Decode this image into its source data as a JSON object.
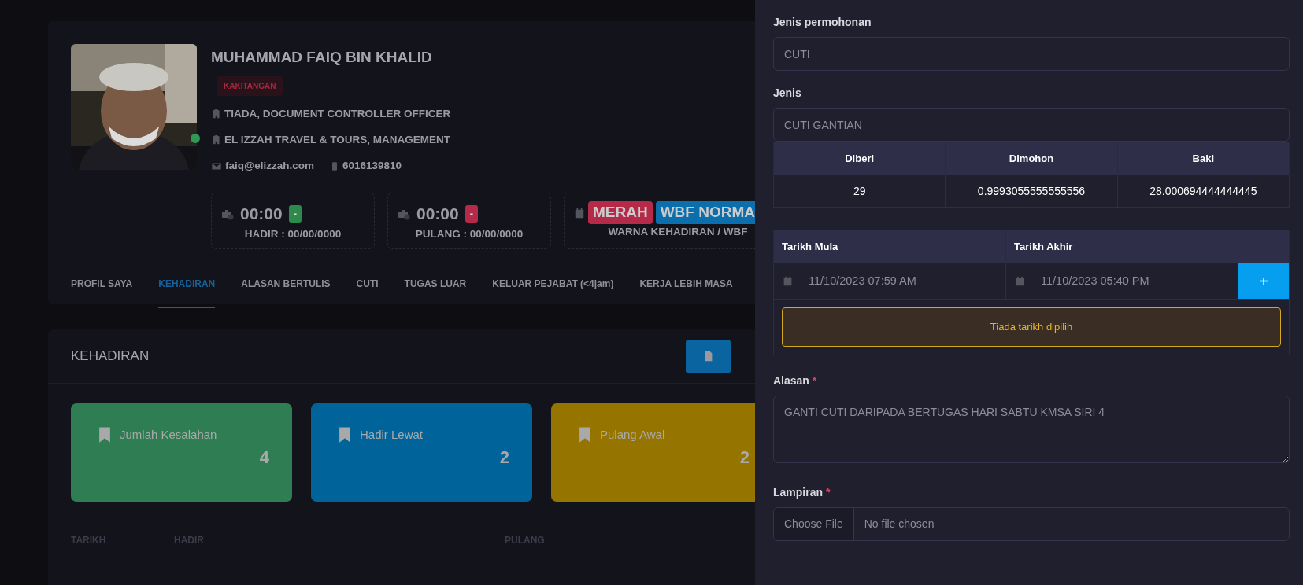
{
  "profile": {
    "name": "MUHAMMAD FAIQ BIN KHALID",
    "role": "KAKITANGAN",
    "position": "TIADA, DOCUMENT CONTROLLER OFFICER",
    "department": "EL IZZAH TRAVEL & TOURS, MANAGEMENT",
    "email": "faiq@elizzah.com",
    "phone": "6016139810",
    "online": true
  },
  "time_cards": [
    {
      "kind": "clock",
      "time": "00:00",
      "badge": "-",
      "color": "#2e8a4c",
      "caption": "HADIR : 00/00/0000"
    },
    {
      "kind": "clock",
      "time": "00:00",
      "badge": "-",
      "color": "#b42a48",
      "caption": "PULANG : 00/00/0000"
    },
    {
      "kind": "tags",
      "tags": [
        {
          "text": "MERAH",
          "color": "#b42a48"
        },
        {
          "text": "WBF NORMA",
          "color": "#0b6fae"
        }
      ],
      "caption": "WARNA KEHADIRAN / WBF"
    }
  ],
  "tabs": [
    {
      "label": "PROFIL SAYA",
      "selected": false
    },
    {
      "label": "KEHADIRAN",
      "selected": true
    },
    {
      "label": "ALASAN BERTULIS",
      "selected": false
    },
    {
      "label": "CUTI",
      "selected": false
    },
    {
      "label": "TUGAS LUAR",
      "selected": false
    },
    {
      "label": "KELUAR PEJABAT (<4jam)",
      "selected": false
    },
    {
      "label": "KERJA LEBIH MASA",
      "selected": false
    }
  ],
  "attendance": {
    "title": "KEHADIRAN",
    "summary": [
      {
        "label": "Jumlah Kesalahan",
        "value": "4",
        "color": "#2f7d52"
      },
      {
        "label": "Hadir Lewat",
        "value": "2",
        "color": "#00639a"
      },
      {
        "label": "Pulang Awal",
        "value": "2",
        "color": "#957400"
      }
    ],
    "columns": [
      "TARIKH",
      "HADIR",
      "PULANG"
    ]
  },
  "form": {
    "request_type": {
      "label": "Jenis permohonan",
      "value": "CUTI"
    },
    "type": {
      "label": "Jenis",
      "value": "CUTI GANTIAN"
    },
    "balance": {
      "columns": [
        "Diberi",
        "Dimohon",
        "Baki"
      ],
      "row": [
        "29",
        "0.9993055555555556",
        "28.000694444444445"
      ]
    },
    "dates": {
      "columns": [
        "Tarikh Mula",
        "Tarikh Akhir"
      ],
      "start": "11/10/2023 07:59 AM",
      "end": "11/10/2023 05:40 PM",
      "add": "+",
      "alert": "Tiada tarikh dipilih"
    },
    "reason": {
      "label": "Alasan",
      "required_mark": "*",
      "value": "GANTI CUTI DARIPADA BERTUGAS HARI SABTU KMSA SIRI 4"
    },
    "attachment": {
      "label": "Lampiran",
      "required_mark": "*",
      "button": "Choose File",
      "status": "No file chosen"
    }
  }
}
